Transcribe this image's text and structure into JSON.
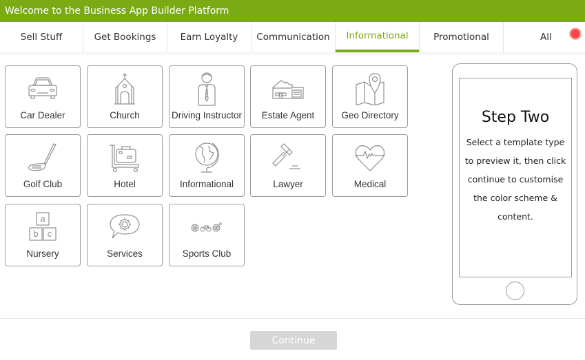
{
  "header": {
    "title": "Welcome to the Business App Builder Platform"
  },
  "tabs": [
    {
      "label": "Sell Stuff",
      "active": false
    },
    {
      "label": "Get Bookings",
      "active": false
    },
    {
      "label": "Earn Loyalty",
      "active": false
    },
    {
      "label": "Communication",
      "active": false
    },
    {
      "label": "Informational",
      "active": true
    },
    {
      "label": "Promotional",
      "active": false
    },
    {
      "label": "All",
      "active": false,
      "has_notification_dot": true
    }
  ],
  "templates": [
    {
      "label": "Car Dealer",
      "icon": "car-icon"
    },
    {
      "label": "Church",
      "icon": "church-icon"
    },
    {
      "label": "Driving Instructor",
      "icon": "instructor-icon"
    },
    {
      "label": "Estate Agent",
      "icon": "house-icon"
    },
    {
      "label": "Geo Directory",
      "icon": "map-pin-icon"
    },
    {
      "label": "Golf Club",
      "icon": "golf-club-icon"
    },
    {
      "label": "Hotel",
      "icon": "luggage-cart-icon"
    },
    {
      "label": "Informational",
      "icon": "globe-icon"
    },
    {
      "label": "Lawyer",
      "icon": "gavel-icon"
    },
    {
      "label": "Medical",
      "icon": "heart-pulse-icon"
    },
    {
      "label": "Nursery",
      "icon": "abc-blocks-icon"
    },
    {
      "label": "Services",
      "icon": "gear-speech-bubble-icon"
    },
    {
      "label": "Sports Club",
      "icon": "sports-icon"
    }
  ],
  "preview": {
    "title": "Step Two",
    "text": "Select a template type to preview it, then click continue to customise the color scheme & content."
  },
  "footer": {
    "continue_label": "Continue",
    "continue_enabled": false
  },
  "colors": {
    "brand": "#7aab14",
    "notification": "#fb4a4a",
    "disabled_button": "#d6d6d6"
  }
}
